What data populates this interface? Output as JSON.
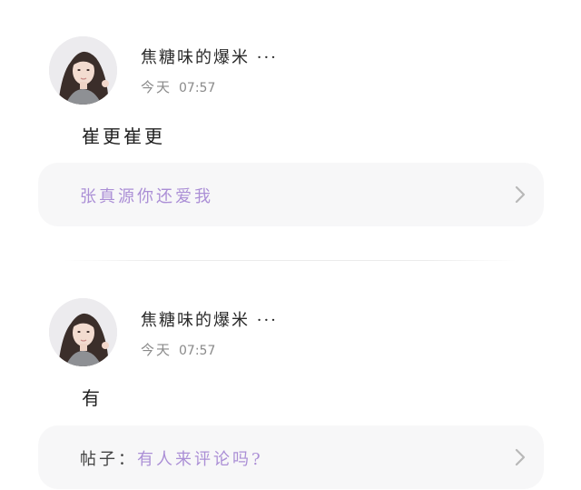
{
  "posts": [
    {
      "username": "焦糖味的爆米 ···",
      "date": "今天",
      "time": "07:57",
      "content": "崔更崔更",
      "card": {
        "prefix": "",
        "text": "张真源你还爱我"
      }
    },
    {
      "username": "焦糖味的爆米 ···",
      "date": "今天",
      "time": "07:57",
      "content": "有",
      "card": {
        "prefix": "帖子：",
        "text": "有人来评论吗?"
      }
    }
  ],
  "icons": {
    "avatar": "avatar-photo",
    "chevron": "chevron-right-icon"
  },
  "colors": {
    "accent": "#ab8fd6",
    "card_bg": "#f7f7f8",
    "muted": "#8a8a8a"
  }
}
